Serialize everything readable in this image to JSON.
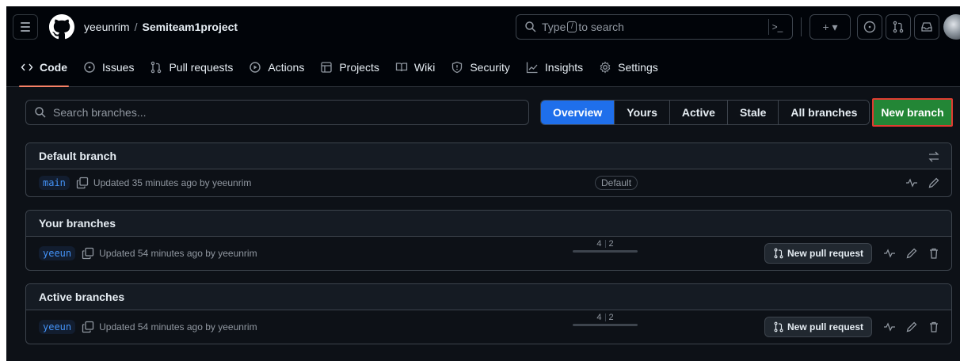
{
  "header": {
    "owner": "yeeunrim",
    "separator": "/",
    "repo": "Semiteam1project",
    "search_prefix": "Type",
    "search_key": "/",
    "search_suffix": "to search",
    "terminal_glyph": ">_",
    "plus_glyph": "+ ▾"
  },
  "nav": {
    "tabs": [
      {
        "label": "Code",
        "icon": "code-icon"
      },
      {
        "label": "Issues",
        "icon": "issue-icon"
      },
      {
        "label": "Pull requests",
        "icon": "pull-request-icon"
      },
      {
        "label": "Actions",
        "icon": "play-icon"
      },
      {
        "label": "Projects",
        "icon": "table-icon"
      },
      {
        "label": "Wiki",
        "icon": "book-icon"
      },
      {
        "label": "Security",
        "icon": "shield-icon"
      },
      {
        "label": "Insights",
        "icon": "graph-icon"
      },
      {
        "label": "Settings",
        "icon": "gear-icon"
      }
    ]
  },
  "branches": {
    "search_placeholder": "Search branches...",
    "filters": [
      "Overview",
      "Yours",
      "Active",
      "Stale",
      "All branches"
    ],
    "selected_filter": "Overview",
    "new_branch_label": "New branch",
    "sections": [
      {
        "title": "Default branch",
        "rows": [
          {
            "name": "main",
            "updated": "Updated 35 minutes ago by yeeunrim",
            "badge": "Default"
          }
        ]
      },
      {
        "title": "Your branches",
        "rows": [
          {
            "name": "yeeun",
            "updated": "Updated 54 minutes ago by yeeunrim",
            "behind": "4",
            "ahead": "2",
            "pr_label": "New pull request"
          }
        ]
      },
      {
        "title": "Active branches",
        "rows": [
          {
            "name": "yeeun",
            "updated": "Updated 54 minutes ago by yeeunrim",
            "behind": "4",
            "ahead": "2",
            "pr_label": "New pull request"
          }
        ]
      }
    ]
  },
  "colors": {
    "accent": "#1f6feb",
    "primary_button": "#238636",
    "highlight_outline": "#e03c31",
    "tab_underline": "#f78166"
  }
}
